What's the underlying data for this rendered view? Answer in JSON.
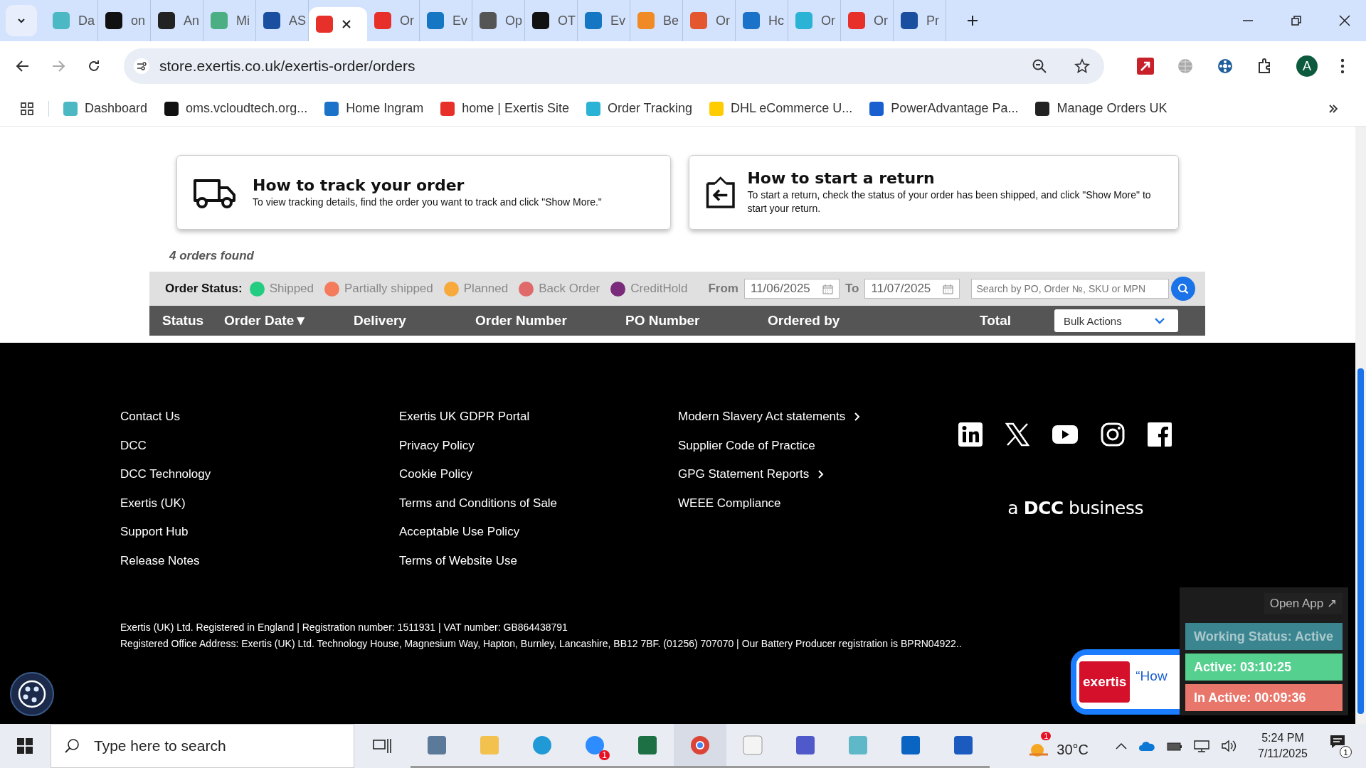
{
  "browser": {
    "tabs": [
      {
        "title": "Da",
        "color": "#4bb8c4",
        "selected": false
      },
      {
        "title": "on",
        "color": "#111111",
        "selected": false
      },
      {
        "title": "An",
        "color": "#222222",
        "selected": false
      },
      {
        "title": "Mi",
        "color": "#4caf84",
        "selected": false
      },
      {
        "title": "AS",
        "color": "#1a4fa0",
        "selected": false
      },
      {
        "color": "#e8302a",
        "selected": true
      },
      {
        "title": "Or",
        "color": "#e8302a",
        "selected": false
      },
      {
        "title": "Ev",
        "color": "#1576c4",
        "selected": false
      },
      {
        "title": "Op",
        "color": "#555555",
        "selected": false
      },
      {
        "title": "OT",
        "color": "#111111",
        "selected": false
      },
      {
        "title": "Ev",
        "color": "#1576c4",
        "selected": false
      },
      {
        "title": "Be",
        "color": "#f08a24",
        "selected": false
      },
      {
        "title": "Or",
        "color": "#e4572e",
        "selected": false
      },
      {
        "title": "Hc",
        "color": "#1a73c8",
        "selected": false
      },
      {
        "title": "Or",
        "color": "#2bb3d6",
        "selected": false
      },
      {
        "title": "Or",
        "color": "#e8302a",
        "selected": false
      },
      {
        "title": "Pr",
        "color": "#1a4fa0",
        "selected": false
      }
    ],
    "address": "store.exertis.co.uk/exertis-order/orders",
    "profile_initial": "A",
    "bookmarks": [
      {
        "label": "Dashboard",
        "color": "#4bb8c4"
      },
      {
        "label": "oms.vcloudtech.org...",
        "color": "#111111"
      },
      {
        "label": "Home Ingram",
        "color": "#1a73c8"
      },
      {
        "label": "home | Exertis Site",
        "color": "#e8302a"
      },
      {
        "label": "Order Tracking",
        "color": "#2bb3d6"
      },
      {
        "label": "DHL eCommerce U...",
        "color": "#ffcc00"
      },
      {
        "label": "PowerAdvantage Pa...",
        "color": "#1a5fd0"
      },
      {
        "label": "Manage Orders UK",
        "color": "#222222"
      }
    ]
  },
  "page": {
    "cards": [
      {
        "kind": "track",
        "title": "How to track your order",
        "text": "To view tracking details, find the order you want to track and click \"Show More.\""
      },
      {
        "kind": "return",
        "title": "How to start a return",
        "text": "To start a return, check the status of your order has been shipped, and click \"Show More\" to start your return."
      }
    ],
    "orders_found": "4 orders found",
    "filter": {
      "label": "Order Status:",
      "statuses": [
        {
          "label": "Shipped",
          "color": "#22cc80"
        },
        {
          "label": "Partially shipped",
          "color": "#f47b5c"
        },
        {
          "label": "Planned",
          "color": "#f7a93b"
        },
        {
          "label": "Back Order",
          "color": "#e06a6a"
        },
        {
          "label": "CreditHold",
          "color": "#7a2a7a"
        }
      ],
      "from_label": "From",
      "from_value": "11/06/2025",
      "to_label": "To",
      "to_value": "11/07/2025",
      "search_placeholder": "Search by PO, Order №, SKU or MPN"
    },
    "table": {
      "columns": [
        "Status",
        "Order Date▼",
        "Delivery",
        "Order Number",
        "PO Number",
        "Ordered by",
        "Total"
      ],
      "bulk_actions": "Bulk Actions"
    }
  },
  "footer": {
    "columns": [
      [
        {
          "label": "Contact Us",
          "chevron": false
        },
        {
          "label": "DCC",
          "chevron": false
        },
        {
          "label": "DCC Technology",
          "chevron": false
        },
        {
          "label": "Exertis (UK)",
          "chevron": false
        },
        {
          "label": "Support Hub",
          "chevron": false
        },
        {
          "label": "Release Notes",
          "chevron": false
        }
      ],
      [
        {
          "label": "Exertis UK GDPR Portal",
          "chevron": false
        },
        {
          "label": "Privacy Policy",
          "chevron": false
        },
        {
          "label": "Cookie Policy",
          "chevron": false
        },
        {
          "label": "Terms and Conditions of Sale",
          "chevron": false
        },
        {
          "label": "Acceptable Use Policy",
          "chevron": false
        },
        {
          "label": "Terms of Website Use",
          "chevron": false
        }
      ],
      [
        {
          "label": "Modern Slavery Act statements",
          "chevron": true
        },
        {
          "label": "Supplier Code of Practice",
          "chevron": false
        },
        {
          "label": "GPG Statement Reports",
          "chevron": true
        },
        {
          "label": "WEEE Compliance",
          "chevron": false
        }
      ]
    ],
    "tagline": "a **DCC** business",
    "legal": [
      "Exertis (UK) Ltd. Registered in England | Registration number: 1511931 | VAT number: GB864438791",
      "Registered Office Address: Exertis (UK) Ltd. Technology House, Magnesium Way, Hapton, Burnley, Lancashire, BB12 7BF. (01256) 707070 | Our Battery Producer registration is BPRN04922.."
    ]
  },
  "chat": {
    "brand": "exertis",
    "text": "“How"
  },
  "tracker": {
    "open_app": "Open App ↗",
    "rows": [
      {
        "kind": "status",
        "label": "Working Status: Active"
      },
      {
        "kind": "active",
        "label": "Active: 03:10:25"
      },
      {
        "kind": "inactive",
        "label": "In Active: 00:09:36"
      }
    ]
  },
  "taskbar": {
    "search_placeholder": "Type here to search",
    "apps": [
      {
        "kind": "calculator",
        "selected": false
      },
      {
        "kind": "folder",
        "selected": false
      },
      {
        "kind": "edge",
        "selected": false
      },
      {
        "kind": "zoom",
        "selected": false,
        "badge": "1"
      },
      {
        "kind": "excel",
        "selected": false
      },
      {
        "kind": "chrome",
        "selected": true
      },
      {
        "kind": "file",
        "selected": false
      },
      {
        "kind": "teams",
        "selected": false
      },
      {
        "kind": "hexagon",
        "selected": false
      },
      {
        "kind": "outlook",
        "selected": false
      },
      {
        "kind": "word",
        "selected": false
      }
    ],
    "weather_badge": "1",
    "temperature": "30°C",
    "time": "5:24 PM",
    "date": "7/11/2025",
    "notifications": "1"
  }
}
